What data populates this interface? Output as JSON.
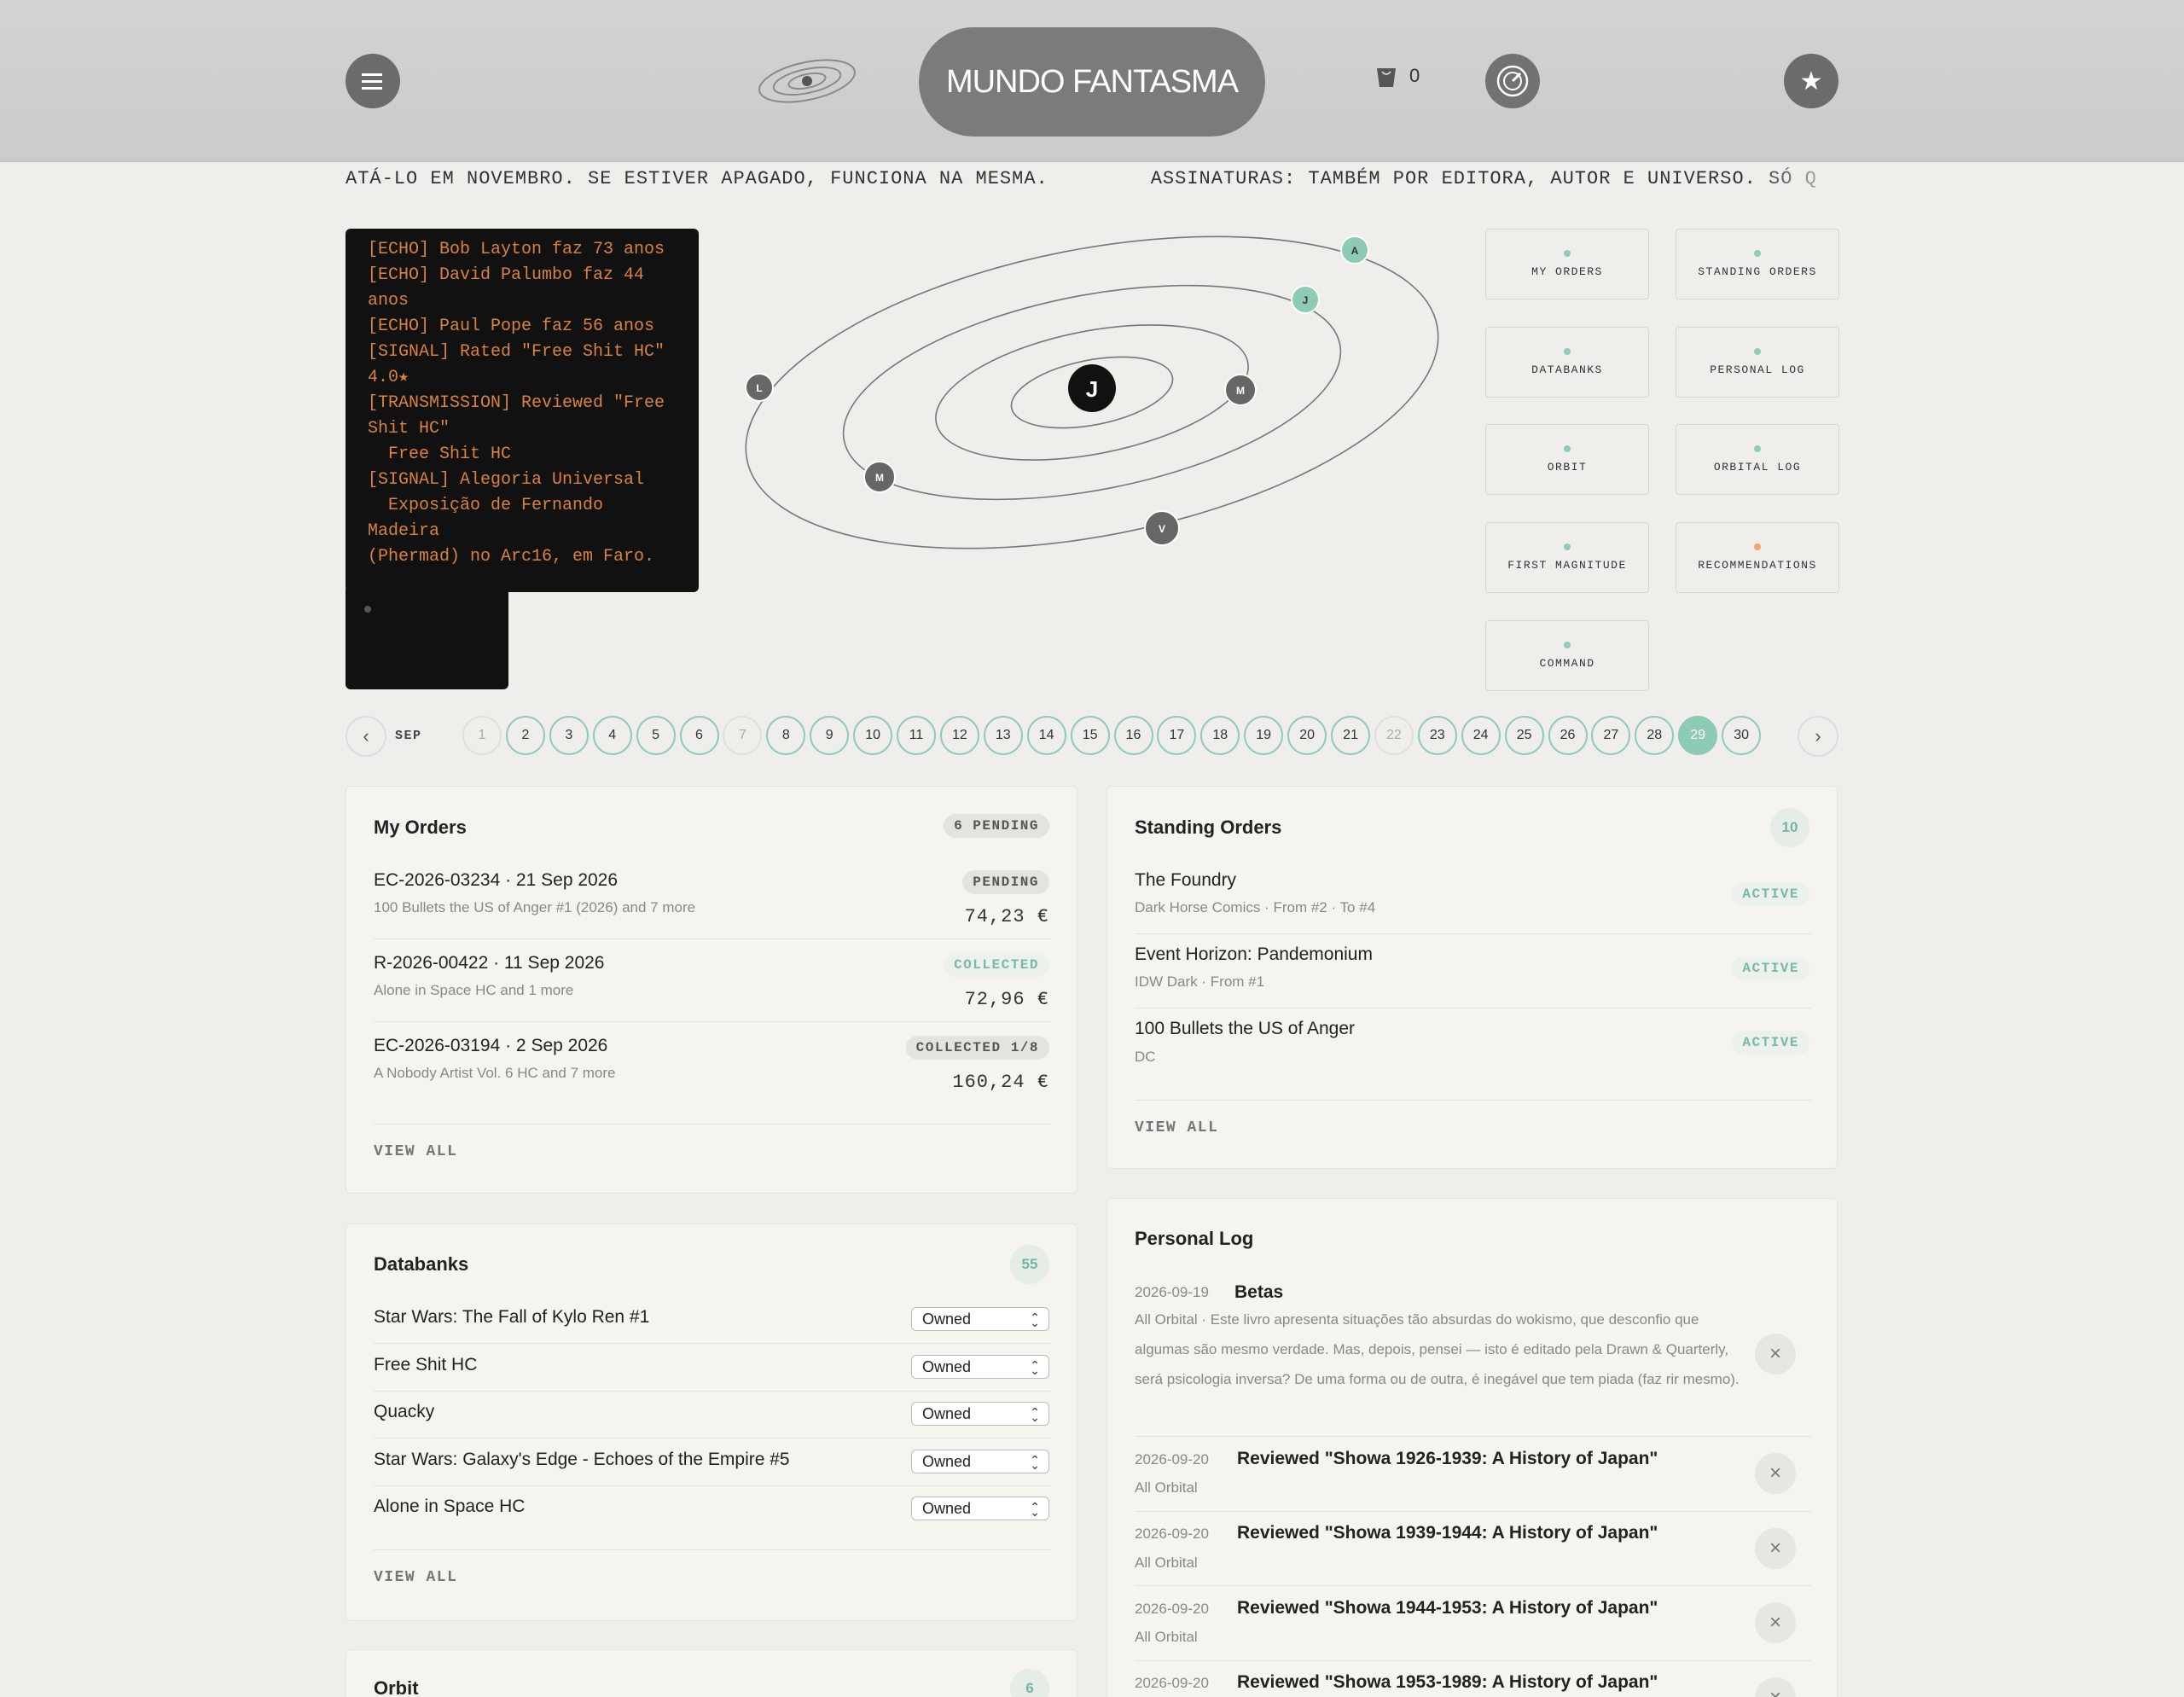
{
  "header": {
    "brand": "MUNDO FANTASMA",
    "cart_count": "0"
  },
  "ticker": {
    "item1": "ATÁ-LO EM NOVEMBRO. SE ESTIVER APAGADO, FUNCIONA NA MESMA.",
    "item2": "ASSINATURAS: TAMBÉM POR EDITORA, AUTOR E UNIVERSO. SÓ Q"
  },
  "terminal": {
    "text": "[ECHO] Bob Layton faz 73 anos\n[ECHO] David Palumbo faz 44\nanos\n[ECHO] Paul Pope faz 56 anos\n[SIGNAL] Rated \"Free Shit HC\"\n4.0★\n[TRANSMISSION] Reviewed \"Free\nShit HC\"\n  Free Shit HC\n[SIGNAL] Alegoria Universal\n  Exposição de Fernando Madeira\n(Phermad) no Arc16, em Faro."
  },
  "orbit": {
    "center": "J",
    "nodes": [
      "A",
      "J",
      "L",
      "M",
      "M",
      "V"
    ]
  },
  "nav": {
    "my_orders": "MY ORDERS",
    "standing_orders": "STANDING ORDERS",
    "databanks": "DATABANKS",
    "personal_log": "PERSONAL LOG",
    "orbit": "ORBIT",
    "orbital_log": "ORBITAL LOG",
    "first_magnitude": "FIRST MAGNITUDE",
    "recommendations": "RECOMMENDATIONS",
    "command": "COMMAND"
  },
  "calendar": {
    "month": "SEP",
    "days": [
      "1",
      "2",
      "3",
      "4",
      "5",
      "6",
      "7",
      "8",
      "9",
      "10",
      "11",
      "12",
      "13",
      "14",
      "15",
      "16",
      "17",
      "18",
      "19",
      "20",
      "21",
      "22",
      "23",
      "24",
      "25",
      "26",
      "27",
      "28",
      "29",
      "30"
    ],
    "off_days": [
      "1",
      "7",
      "22"
    ],
    "selected": "29"
  },
  "my_orders": {
    "title": "My Orders",
    "badge": "6 PENDING",
    "rows": [
      {
        "title": "EC-2026-03234 · 21 Sep 2026",
        "sub": "100 Bullets the US of Anger #1 (2026) and 7 more",
        "status": "PENDING",
        "price": "74,23 €"
      },
      {
        "title": "R-2026-00422 · 11 Sep 2026",
        "sub": "Alone in Space HC and 1 more",
        "status": "COLLECTED",
        "price": "72,96 €"
      },
      {
        "title": "EC-2026-03194 · 2 Sep 2026",
        "sub": "A Nobody Artist Vol. 6 HC and 7 more",
        "status": "COLLECTED 1/8",
        "price": "160,24 €"
      }
    ],
    "view_all": "VIEW ALL"
  },
  "standing_orders": {
    "title": "Standing Orders",
    "count": "10",
    "rows": [
      {
        "title": "The Foundry",
        "sub": "Dark Horse Comics · From #2 · To #4",
        "status": "ACTIVE"
      },
      {
        "title": "Event Horizon: Pandemonium",
        "sub": "IDW Dark · From #1",
        "status": "ACTIVE"
      },
      {
        "title": "100 Bullets the US of Anger",
        "sub": "DC",
        "status": "ACTIVE"
      }
    ],
    "view_all": "VIEW ALL"
  },
  "databanks": {
    "title": "Databanks",
    "count": "55",
    "rows": [
      {
        "title": "Star Wars: The Fall of Kylo Ren #1",
        "value": "Owned"
      },
      {
        "title": "Free Shit HC",
        "value": "Owned"
      },
      {
        "title": "Quacky",
        "value": "Owned"
      },
      {
        "title": "Star Wars: Galaxy's Edge - Echoes of the Empire #5",
        "value": "Owned"
      },
      {
        "title": "Alone in Space HC",
        "value": "Owned"
      }
    ],
    "view_all": "VIEW ALL"
  },
  "personal_log": {
    "title": "Personal Log",
    "entries": [
      {
        "date": "2026-09-19",
        "title": "Betas",
        "body": "All Orbital · Este livro apresenta situações tão absurdas do wokismo, que desconfio que algumas são mesmo verdade. Mas, depois, pensei — isto é editado pela Drawn & Quarterly, será psicologia inversa? De uma forma ou de outra, é inegável que tem piada (faz rir mesmo)."
      },
      {
        "date": "2026-09-20",
        "title": "Reviewed \"Showa 1926-1939: A History of Japan\"",
        "body": "All Orbital"
      },
      {
        "date": "2026-09-20",
        "title": "Reviewed \"Showa 1939-1944: A History of Japan\"",
        "body": "All Orbital"
      },
      {
        "date": "2026-09-20",
        "title": "Reviewed \"Showa 1944-1953: A History of Japan\"",
        "body": "All Orbital"
      },
      {
        "date": "2026-09-20",
        "title": "Reviewed \"Showa 1953-1989: A History of Japan\"",
        "body": ""
      }
    ]
  },
  "orbit_card": {
    "title": "Orbit",
    "count": "6"
  }
}
